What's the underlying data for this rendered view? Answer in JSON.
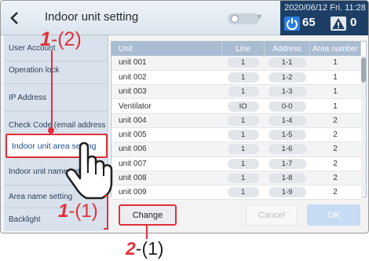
{
  "header": {
    "title": "Indoor unit setting",
    "datetime": "2020/06/12 Fri. 11:28",
    "power_count": "65",
    "alarm_count": "0"
  },
  "sidebar": {
    "items": [
      {
        "label": "User Account"
      },
      {
        "label": "Operation lock"
      },
      {
        "label": "IP Address"
      },
      {
        "label": "Check Code (email address"
      },
      {
        "label": "Indoor unit area setting"
      },
      {
        "label": "Indoor unit name setting"
      },
      {
        "label": "Area name setting"
      },
      {
        "label": "Backlight"
      }
    ],
    "selected_index": 4
  },
  "table": {
    "columns": [
      "Unit",
      "Line",
      "Address",
      "Area number"
    ],
    "rows": [
      [
        "unit 001",
        "1",
        "1-1",
        "1"
      ],
      [
        "unit 002",
        "1",
        "1-2",
        "1"
      ],
      [
        "unit 003",
        "1",
        "1-3",
        "1"
      ],
      [
        "Ventilator",
        "IO",
        "0-0",
        "1"
      ],
      [
        "unit 004",
        "1",
        "1-4",
        "2"
      ],
      [
        "unit 005",
        "1",
        "1-5",
        "2"
      ],
      [
        "unit 006",
        "1",
        "1-6",
        "2"
      ],
      [
        "unit 007",
        "1",
        "1-7",
        "2"
      ],
      [
        "unit 008",
        "1",
        "1-8",
        "2"
      ],
      [
        "unit 009",
        "1",
        "1-9",
        "2"
      ]
    ]
  },
  "buttons": {
    "change": "Change",
    "cancel": "Cancel",
    "ok": "OK"
  },
  "callouts": {
    "c1_num": "1",
    "c1_step2": "-(2)",
    "c1_step1": "-(1)",
    "c2_num": "2",
    "c2_step1": "-(1)"
  },
  "colors": {
    "highlight": "#e0303a",
    "status_bar": "#1d3f66",
    "table_header": "#a9bcd1"
  }
}
